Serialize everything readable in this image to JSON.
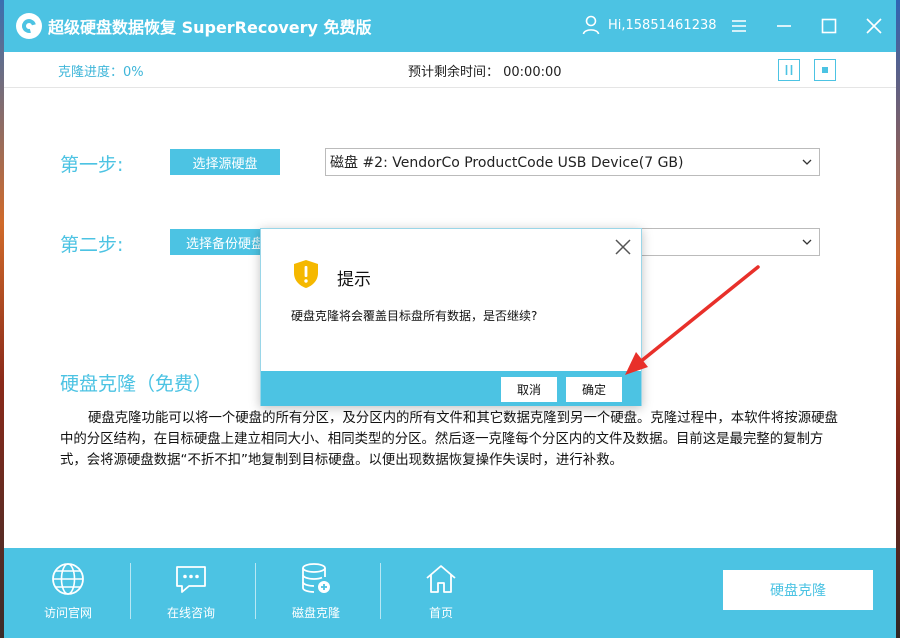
{
  "app": {
    "title": "超级硬盘数据恢复 SuperRecovery 免费版",
    "user": "Hi,15851461238"
  },
  "status": {
    "clone_progress": "克隆进度：0%",
    "time_remaining": "预计剩余时间：  00:00:00"
  },
  "steps": [
    {
      "label": "第一步:",
      "button": "选择源硬盘",
      "selected": "磁盘 #2: VendorCo ProductCode USB Device(7 GB)"
    },
    {
      "label": "第二步:",
      "button": "选择备份硬盘",
      "selected": ""
    }
  ],
  "section": {
    "title": "硬盘克隆（免费）",
    "description": "硬盘克隆功能可以将一个硬盘的所有分区，及分区内的所有文件和其它数据克隆到另一个硬盘。克隆过程中，本软件将按源硬盘中的分区结构，在目标硬盘上建立相同大小、相同类型的分区。然后逐一克隆每个分区内的文件及数据。目前这是最完整的复制方式，会将源硬盘数据“不折不扣”地复制到目标硬盘。以便出现数据恢复操作失误时，进行补救。"
  },
  "nav": [
    {
      "label": "访问官网",
      "icon": "globe-icon"
    },
    {
      "label": "在线咨询",
      "icon": "chat-icon"
    },
    {
      "label": "磁盘克隆",
      "icon": "database-icon"
    },
    {
      "label": "首页",
      "icon": "home-icon"
    }
  ],
  "main_action": "硬盘克隆",
  "dialog": {
    "title": "提示",
    "message": "硬盘克隆将会覆盖目标盘所有数据，是否继续?",
    "cancel": "取消",
    "ok": "确定",
    "icon": "shield-warning-icon"
  },
  "colors": {
    "accent": "#4cc3e3",
    "warning": "#f5b800",
    "annotation": "#e8302a"
  }
}
